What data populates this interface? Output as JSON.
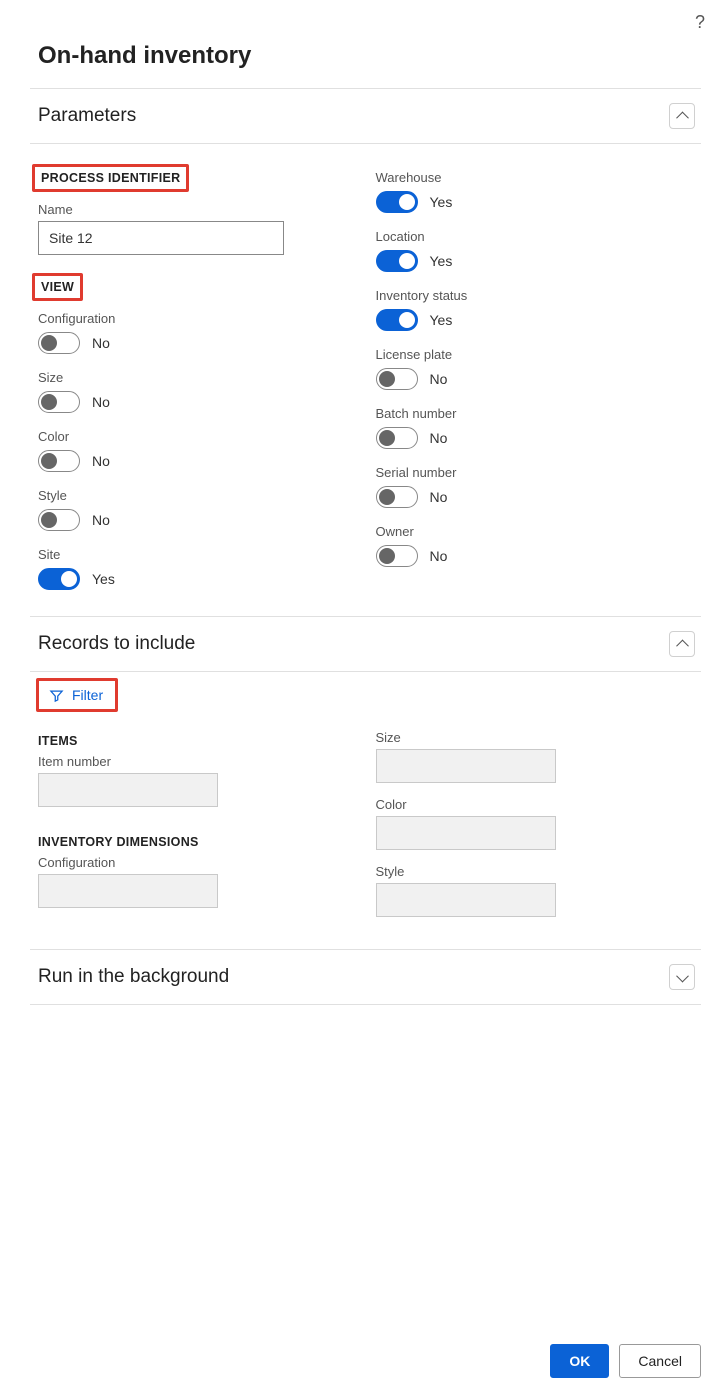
{
  "page_title": "On-hand inventory",
  "help_aria": "Help",
  "sections": {
    "parameters": {
      "title": "Parameters",
      "expanded": true
    },
    "records": {
      "title": "Records to include",
      "expanded": true
    },
    "background": {
      "title": "Run in the background",
      "expanded": false
    }
  },
  "process_identifier": {
    "group_label": "PROCESS IDENTIFIER",
    "name_label": "Name",
    "name_value": "Site 12"
  },
  "view": {
    "group_label": "VIEW",
    "left": [
      {
        "label": "Configuration",
        "on": false,
        "text": "No",
        "name": "toggle-configuration"
      },
      {
        "label": "Size",
        "on": false,
        "text": "No",
        "name": "toggle-size"
      },
      {
        "label": "Color",
        "on": false,
        "text": "No",
        "name": "toggle-color"
      },
      {
        "label": "Style",
        "on": false,
        "text": "No",
        "name": "toggle-style"
      },
      {
        "label": "Site",
        "on": true,
        "text": "Yes",
        "name": "toggle-site"
      }
    ],
    "right": [
      {
        "label": "Warehouse",
        "on": true,
        "text": "Yes",
        "name": "toggle-warehouse"
      },
      {
        "label": "Location",
        "on": true,
        "text": "Yes",
        "name": "toggle-location"
      },
      {
        "label": "Inventory status",
        "on": true,
        "text": "Yes",
        "name": "toggle-inventory-status"
      },
      {
        "label": "License plate",
        "on": false,
        "text": "No",
        "name": "toggle-license-plate"
      },
      {
        "label": "Batch number",
        "on": false,
        "text": "No",
        "name": "toggle-batch-number"
      },
      {
        "label": "Serial number",
        "on": false,
        "text": "No",
        "name": "toggle-serial-number"
      },
      {
        "label": "Owner",
        "on": false,
        "text": "No",
        "name": "toggle-owner"
      }
    ]
  },
  "records_filter": {
    "label": "Filter"
  },
  "records_items": {
    "group_label": "ITEMS",
    "fields": [
      {
        "label": "Item number",
        "value": "",
        "name": "item-number-field"
      }
    ]
  },
  "records_inventory_dimensions": {
    "group_label": "INVENTORY DIMENSIONS",
    "left_fields": [
      {
        "label": "Configuration",
        "value": "",
        "name": "configuration-field"
      }
    ],
    "right_fields": [
      {
        "label": "Size",
        "value": "",
        "name": "size-field"
      },
      {
        "label": "Color",
        "value": "",
        "name": "color-field"
      },
      {
        "label": "Style",
        "value": "",
        "name": "style-field"
      }
    ]
  },
  "footer": {
    "ok": "OK",
    "cancel": "Cancel"
  }
}
